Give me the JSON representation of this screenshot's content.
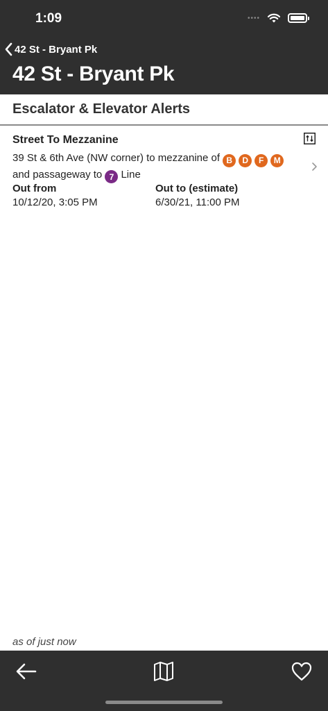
{
  "status_bar": {
    "time": "1:09"
  },
  "nav": {
    "back_label": "42 St - Bryant Pk",
    "title": "42 St - Bryant Pk"
  },
  "section": {
    "title": "Escalator & Elevator Alerts"
  },
  "alert": {
    "title": "Street To Mezzanine",
    "type_icon": "escalator-icon",
    "desc_part1": "39 St & 6th Ave (NW corner) to mezzanine of",
    "lines_orange": [
      "B",
      "D",
      "F",
      "M"
    ],
    "desc_part2": "and passageway to",
    "line_purple": "7",
    "desc_part3": "Line",
    "out_from_label": "Out from",
    "out_from_value": "10/12/20, 3:05 PM",
    "out_to_label": "Out to (estimate)",
    "out_to_value": "6/30/21, 11:00 PM"
  },
  "footer": {
    "as_of": "as of just now"
  },
  "colors": {
    "header": "#2f2f2f",
    "orange_line": "#e0681e",
    "purple_line": "#7a2a86"
  },
  "toolbar": {
    "icons": [
      "arrow-left-icon",
      "map-icon",
      "heart-icon"
    ]
  }
}
